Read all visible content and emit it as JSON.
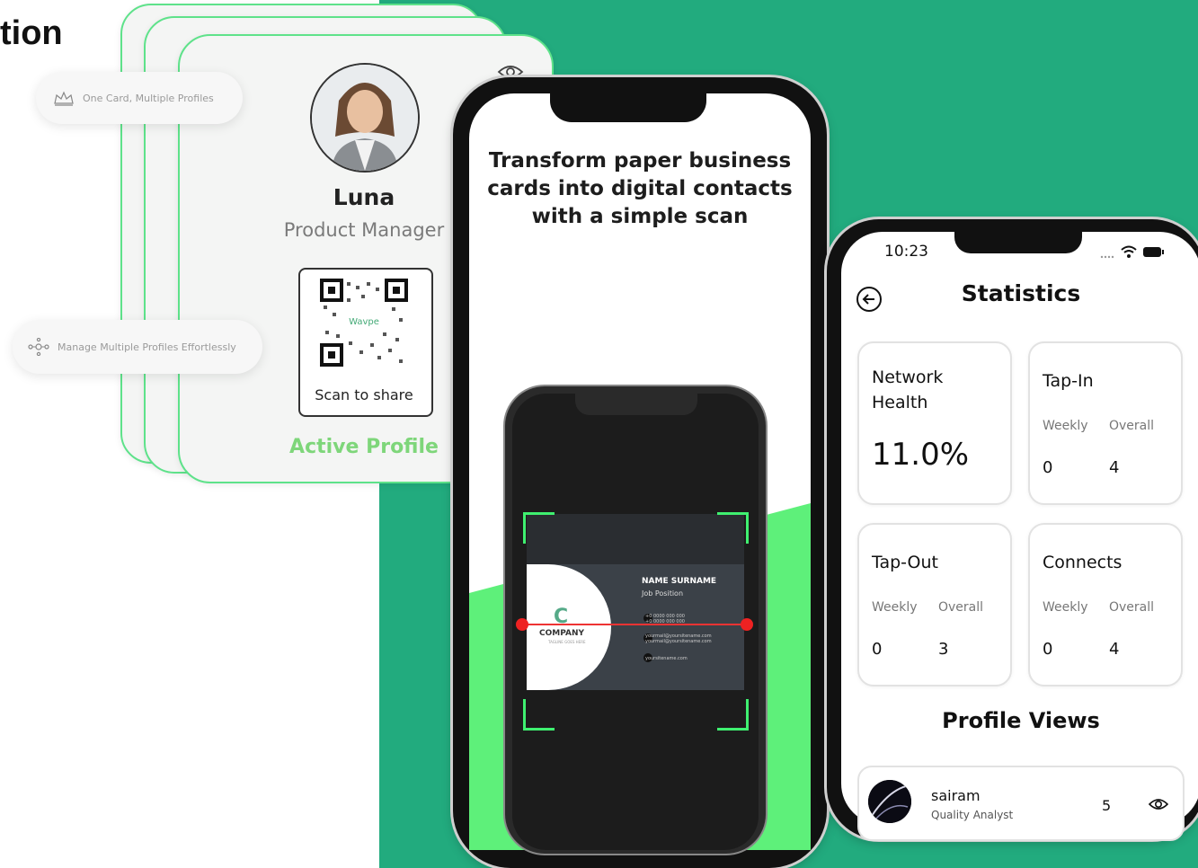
{
  "heading": "tion",
  "profile_cards": {
    "pill_one_card": "One Card, Multiple Profiles",
    "pill_manage": "Manage Multiple Profiles Effortlessly",
    "name": "Luna",
    "role": "Product Manager",
    "qr_brand": "Wavpe",
    "scan_label": "Scan to share",
    "status": "Active Profile"
  },
  "scanner_phone": {
    "headline_line1": "Transform paper business",
    "headline_line2": "cards into digital contacts",
    "headline_line3": "with a simple scan",
    "card_name": "NAME SURNAME",
    "card_job": "Job Position",
    "card_company": "COMPANY",
    "card_logo": "C",
    "card_tagline": "TAGLINE GOES HERE",
    "card_phone": "+0 0000 000 000",
    "card_phone2": "+0 0000 000 000",
    "card_email": "yourmail@yoursitename.com",
    "card_email2": "yourmail@yoursitename.com",
    "card_site": "yoursitename.com"
  },
  "stats_phone": {
    "time": "10:23",
    "title": "Statistics",
    "network_health": {
      "label_line1": "Network",
      "label_line2": "Health",
      "value": "11.0%"
    },
    "tap_in": {
      "label": "Tap-In",
      "weekly_label": "Weekly",
      "overall_label": "Overall",
      "weekly": "0",
      "overall": "4"
    },
    "tap_out": {
      "label": "Tap-Out",
      "weekly_label": "Weekly",
      "overall_label": "Overall",
      "weekly": "0",
      "overall": "3"
    },
    "connects": {
      "label": "Connects",
      "weekly_label": "Weekly",
      "overall_label": "Overall",
      "weekly": "0",
      "overall": "4"
    },
    "profile_views_title": "Profile Views",
    "viewer": {
      "name": "sairam",
      "role": "Quality Analyst",
      "count": "5"
    }
  },
  "colors": {
    "brand_green": "#22ab7e",
    "accent_green": "#5ef07a",
    "active_green": "#7ed67a"
  }
}
